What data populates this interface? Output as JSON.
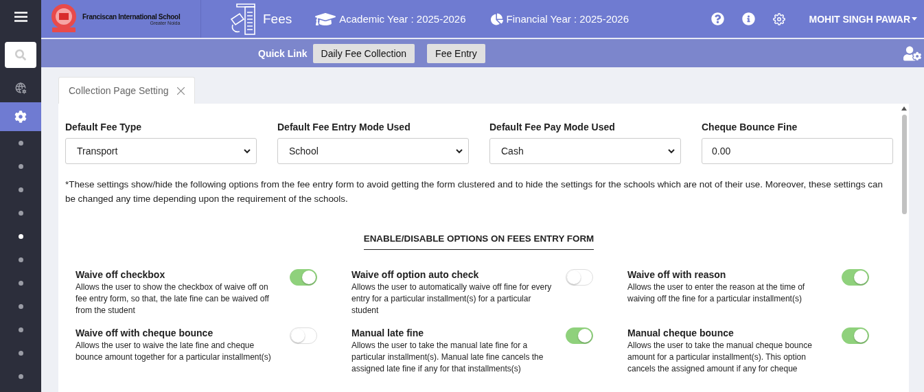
{
  "school": {
    "name": "Franciscan International School",
    "place": "Greater Noida"
  },
  "module": {
    "title": "Fees"
  },
  "academic_year": "Academic Year : 2025-2026",
  "financial_year": "Financial Year : 2025-2026",
  "user": {
    "name": "MOHIT SINGH PAWAR"
  },
  "quick_links": {
    "label": "Quick Link",
    "buttons": [
      "Daily Fee Collection",
      "Fee Entry"
    ]
  },
  "sidebar": {
    "items": [
      {
        "kind": "globe",
        "selected": false
      },
      {
        "kind": "gear",
        "selected": true
      },
      {
        "kind": "dot",
        "selected": false
      },
      {
        "kind": "dot",
        "selected": false
      },
      {
        "kind": "dot",
        "selected": false
      },
      {
        "kind": "dot",
        "selected": false
      },
      {
        "kind": "dot",
        "selected": true
      },
      {
        "kind": "dot",
        "selected": false
      },
      {
        "kind": "dot",
        "selected": false
      },
      {
        "kind": "dot",
        "selected": false
      },
      {
        "kind": "dot",
        "selected": false
      },
      {
        "kind": "dot",
        "selected": false
      },
      {
        "kind": "dot",
        "selected": false
      }
    ]
  },
  "tabs": [
    {
      "label": "Collection Page Setting",
      "selected": true
    }
  ],
  "fields": [
    {
      "label": "Default Fee Type",
      "kind": "select",
      "value": "Transport"
    },
    {
      "label": "Default Fee Entry Mode Used",
      "kind": "select",
      "value": "School"
    },
    {
      "label": "Default Fee Pay Mode Used",
      "kind": "select",
      "value": "Cash"
    },
    {
      "label": "Cheque Bounce Fine",
      "kind": "input",
      "value": "0.00"
    }
  ],
  "note": "*These settings show/hide the following options from the fee entry form to avoid getting the form clustered and to hide the settings for the schools which are not of their use. Moreover, these settings can be changed any time depending upon the requirement of the schools.",
  "section_title": "ENABLE/DISABLE OPTIONS ON FEES ENTRY FORM",
  "options": [
    {
      "title": "Waive off checkbox",
      "description": "Allows the user to show the checkbox of waive off on fee entry form, so that, the late fine can be waived off from the student",
      "on": true
    },
    {
      "title": "Waive off option auto check",
      "description": "Allows the user to automatically waive off fine for every entry for a particular installment(s) for a particular student",
      "on": false
    },
    {
      "title": "Waive off with reason",
      "description": "Allows the user to enter the reason at the time of waiving off the fine for a particular installment(s)",
      "on": true
    },
    {
      "title": "Waive off with cheque bounce",
      "description": "Allows the user to waive the late fine and cheque bounce amount together for a particular installment(s)",
      "on": false
    },
    {
      "title": "Manual late fine",
      "description": "Allows the user to take the manual late fine for a particular installment(s). Manual late fine cancels the assigned late fine if any for that installments(s)",
      "on": true
    },
    {
      "title": "Manual cheque bounce",
      "description": "Allows the user to take the manual cheque bounce amount for a particular installment(s). This option cancels the assigned amount if any for cheque",
      "on": true
    }
  ]
}
